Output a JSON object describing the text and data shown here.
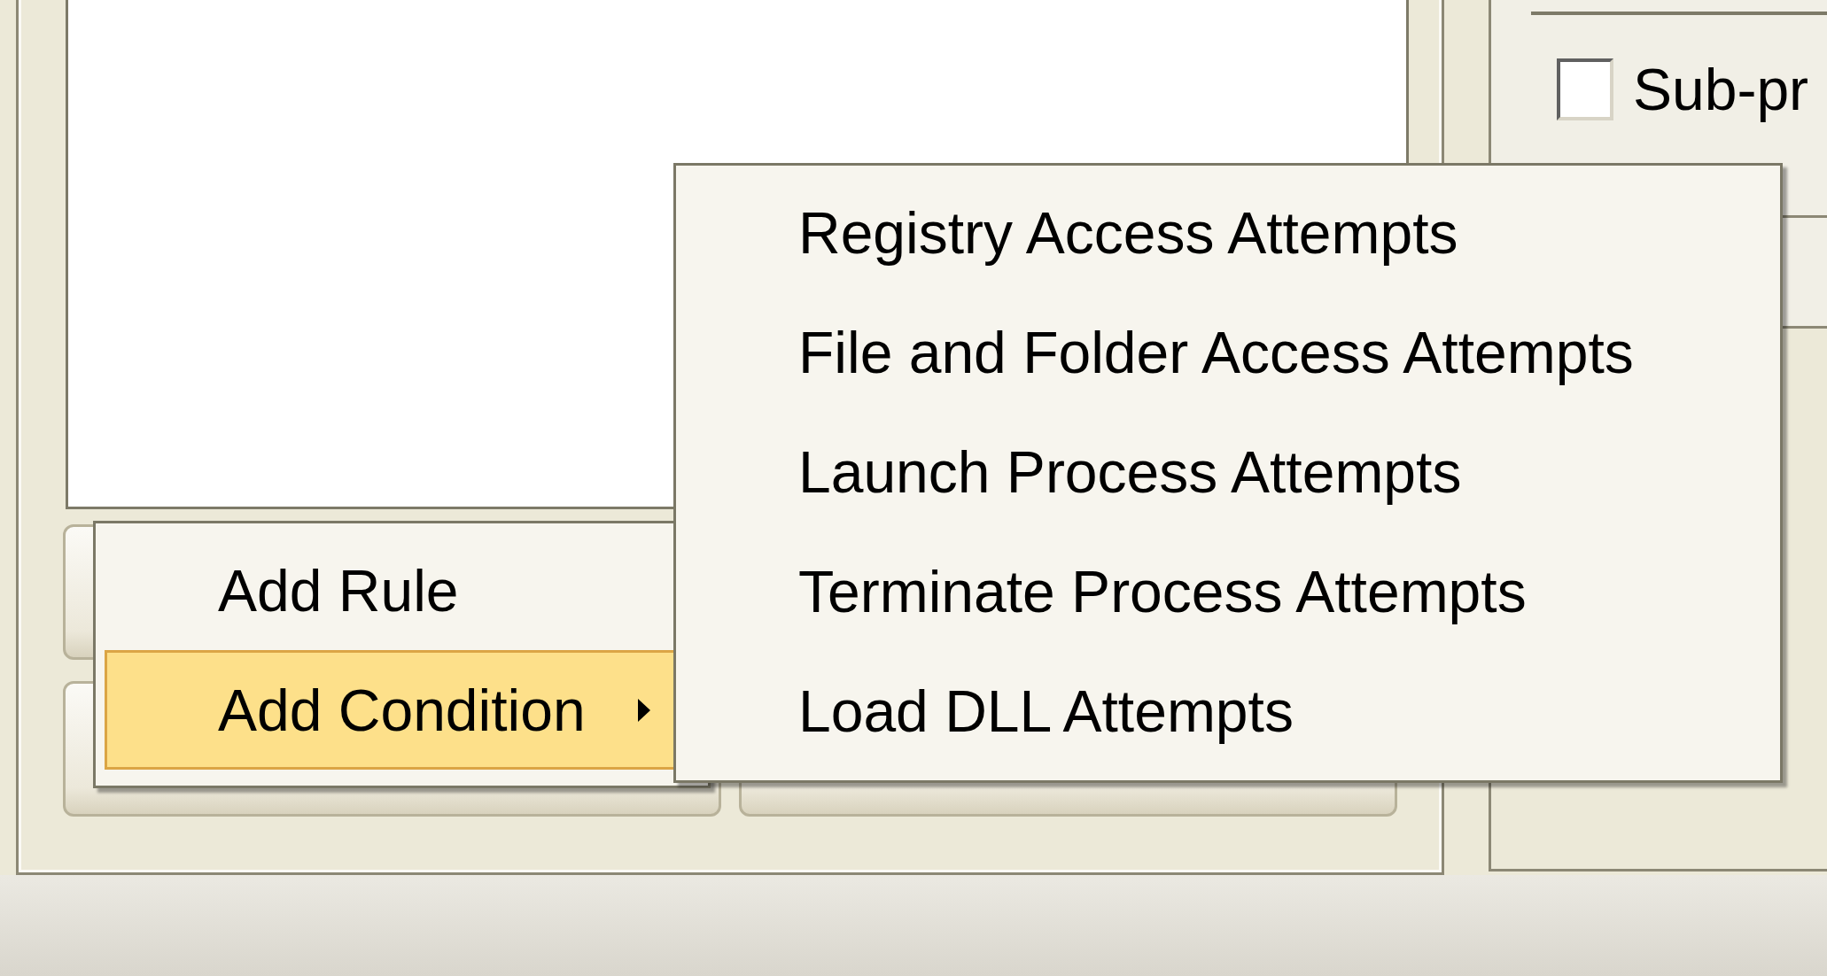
{
  "options": {
    "checkbox": {
      "label": "Sub-pr",
      "checked": false
    }
  },
  "context_menu": {
    "items": [
      {
        "label": "Add Rule",
        "selected": false,
        "has_submenu": false
      },
      {
        "label": "Add Condition",
        "selected": true,
        "has_submenu": true
      }
    ]
  },
  "submenu": {
    "items": [
      {
        "label": "Registry Access Attempts",
        "selected": false
      },
      {
        "label": "File and Folder Access Attempts",
        "selected": false
      },
      {
        "label": "Launch Process Attempts",
        "selected": false
      },
      {
        "label": "Terminate Process Attempts",
        "selected": false
      },
      {
        "label": "Load DLL Attempts",
        "selected": false
      }
    ]
  }
}
